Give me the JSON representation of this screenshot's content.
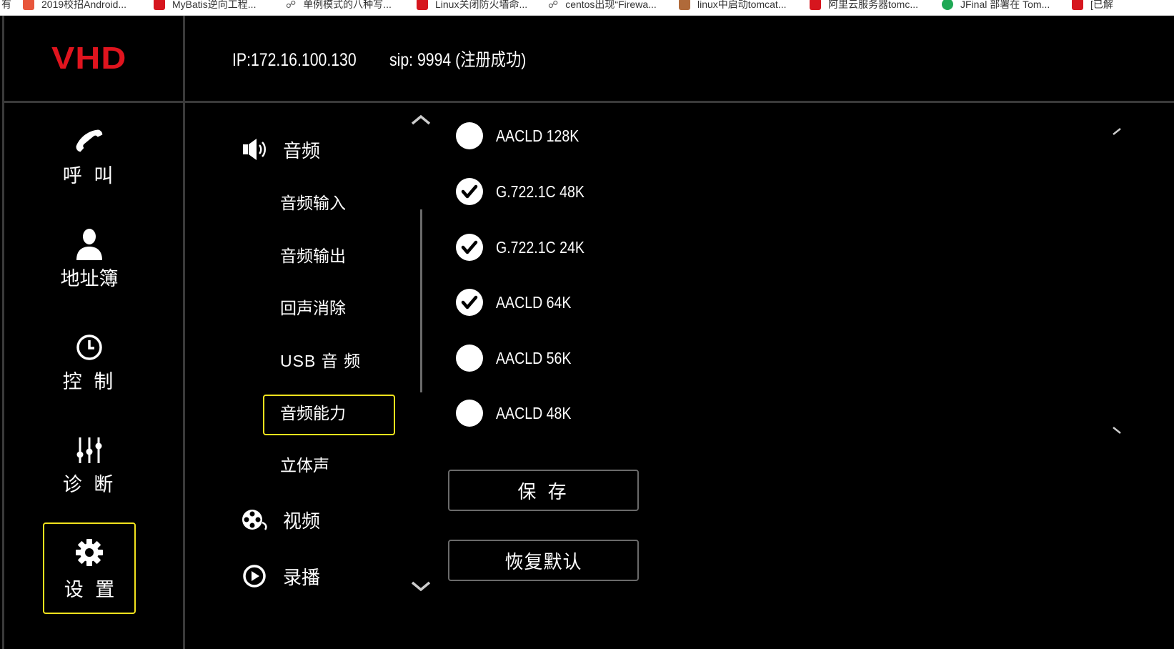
{
  "bookmarks": [
    {
      "title": "有",
      "icon": "none"
    },
    {
      "title": "2019校招Android...",
      "icon": "orange"
    },
    {
      "title": "MyBatis逆向工程...",
      "icon": "red"
    },
    {
      "title": "单例模式的八种写...",
      "icon": "gray"
    },
    {
      "title": "Linux关闭防火墙命...",
      "icon": "red"
    },
    {
      "title": "centos出现“Firewa...",
      "icon": "gray"
    },
    {
      "title": "linux中启动tomcat...",
      "icon": "brown"
    },
    {
      "title": "阿里云服务器tomc...",
      "icon": "red"
    },
    {
      "title": "JFinal 部署在 Tom...",
      "icon": "green"
    },
    {
      "title": "[已解",
      "icon": "red"
    }
  ],
  "header": {
    "logo": "VHD",
    "ip": "IP:172.16.100.130",
    "sip": "sip: 9994 (注册成功)"
  },
  "nav": [
    {
      "label": "呼 叫",
      "icon": "phone-icon"
    },
    {
      "label": "地址簿",
      "icon": "user-icon"
    },
    {
      "label": "控 制",
      "icon": "clock-icon"
    },
    {
      "label": "诊 断",
      "icon": "sliders-icon"
    },
    {
      "label": "设 置",
      "icon": "gear-icon",
      "selected": true
    }
  ],
  "menu": {
    "audio": "音频",
    "video": "视频",
    "record": "录播",
    "sub_items": [
      "音频输入",
      "音频输出",
      "回声消除",
      "USB 音 频",
      "音频能力",
      "立体声"
    ],
    "selected_sub": "音频能力"
  },
  "codecs": [
    {
      "label": "AACLD 128K",
      "checked": false
    },
    {
      "label": "G.722.1C 48K",
      "checked": true
    },
    {
      "label": "G.722.1C 24K",
      "checked": true
    },
    {
      "label": "AACLD 64K",
      "checked": true
    },
    {
      "label": "AACLD 56K",
      "checked": false
    },
    {
      "label": "AACLD 48K",
      "checked": false
    }
  ],
  "buttons": {
    "save": "保 存",
    "restore": "恢复默认"
  },
  "colors": {
    "accent_yellow": "#f2e21d",
    "logo_red": "#e0141e",
    "background": "#000000"
  }
}
